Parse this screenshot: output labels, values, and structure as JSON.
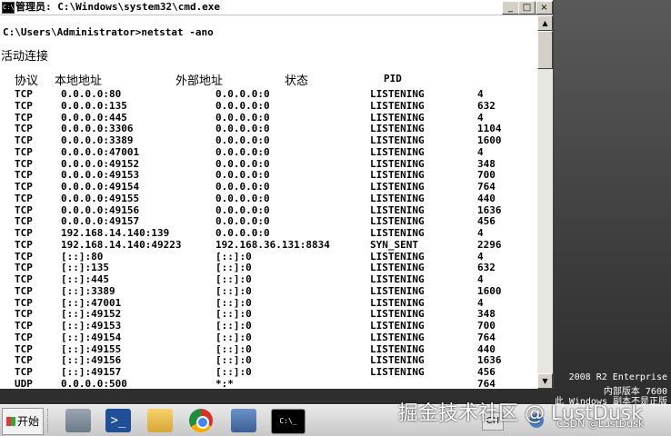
{
  "window": {
    "title": "管理员: C:\\Windows\\system32\\cmd.exe",
    "min": "_",
    "max": "□",
    "close": "×"
  },
  "console": {
    "prompt": "C:\\Users\\Administrator>netstat -ano",
    "section": "活动连接",
    "headers": {
      "proto": "协议",
      "local": "本地地址",
      "foreign": "外部地址",
      "state": "状态",
      "pid": "PID"
    },
    "rows": [
      [
        "TCP",
        "0.0.0.0:80",
        "0.0.0.0:0",
        "LISTENING",
        "4"
      ],
      [
        "TCP",
        "0.0.0.0:135",
        "0.0.0.0:0",
        "LISTENING",
        "632"
      ],
      [
        "TCP",
        "0.0.0.0:445",
        "0.0.0.0:0",
        "LISTENING",
        "4"
      ],
      [
        "TCP",
        "0.0.0.0:3306",
        "0.0.0.0:0",
        "LISTENING",
        "1104"
      ],
      [
        "TCP",
        "0.0.0.0:3389",
        "0.0.0.0:0",
        "LISTENING",
        "1600"
      ],
      [
        "TCP",
        "0.0.0.0:47001",
        "0.0.0.0:0",
        "LISTENING",
        "4"
      ],
      [
        "TCP",
        "0.0.0.0:49152",
        "0.0.0.0:0",
        "LISTENING",
        "348"
      ],
      [
        "TCP",
        "0.0.0.0:49153",
        "0.0.0.0:0",
        "LISTENING",
        "700"
      ],
      [
        "TCP",
        "0.0.0.0:49154",
        "0.0.0.0:0",
        "LISTENING",
        "764"
      ],
      [
        "TCP",
        "0.0.0.0:49155",
        "0.0.0.0:0",
        "LISTENING",
        "440"
      ],
      [
        "TCP",
        "0.0.0.0:49156",
        "0.0.0.0:0",
        "LISTENING",
        "1636"
      ],
      [
        "TCP",
        "0.0.0.0:49157",
        "0.0.0.0:0",
        "LISTENING",
        "456"
      ],
      [
        "TCP",
        "192.168.14.140:139",
        "0.0.0.0:0",
        "LISTENING",
        "4"
      ],
      [
        "TCP",
        "192.168.14.140:49223",
        "192.168.36.131:8834",
        "SYN_SENT",
        "2296"
      ],
      [
        "TCP",
        "[::]:80",
        "[::]:0",
        "LISTENING",
        "4"
      ],
      [
        "TCP",
        "[::]:135",
        "[::]:0",
        "LISTENING",
        "632"
      ],
      [
        "TCP",
        "[::]:445",
        "[::]:0",
        "LISTENING",
        "4"
      ],
      [
        "TCP",
        "[::]:3389",
        "[::]:0",
        "LISTENING",
        "1600"
      ],
      [
        "TCP",
        "[::]:47001",
        "[::]:0",
        "LISTENING",
        "4"
      ],
      [
        "TCP",
        "[::]:49152",
        "[::]:0",
        "LISTENING",
        "348"
      ],
      [
        "TCP",
        "[::]:49153",
        "[::]:0",
        "LISTENING",
        "700"
      ],
      [
        "TCP",
        "[::]:49154",
        "[::]:0",
        "LISTENING",
        "764"
      ],
      [
        "TCP",
        "[::]:49155",
        "[::]:0",
        "LISTENING",
        "440"
      ],
      [
        "TCP",
        "[::]:49156",
        "[::]:0",
        "LISTENING",
        "1636"
      ],
      [
        "TCP",
        "[::]:49157",
        "[::]:0",
        "LISTENING",
        "456"
      ],
      [
        "UDP",
        "0.0.0.0:500",
        "*:*",
        "",
        "764"
      ]
    ]
  },
  "os_watermark": {
    "line1": "2008 R2 Enterprise",
    "line2": "内部版本 7600",
    "line3": "此 Windows 副本不是正版"
  },
  "taskbar": {
    "start_label": "开始",
    "cmd_label": "C:\\_",
    "lang": "CH",
    "ps_glyph": ">_"
  },
  "overlay": {
    "brand": "掘金技术社区 @ LustDusk",
    "csdn": "CSDN @LustDusk"
  }
}
